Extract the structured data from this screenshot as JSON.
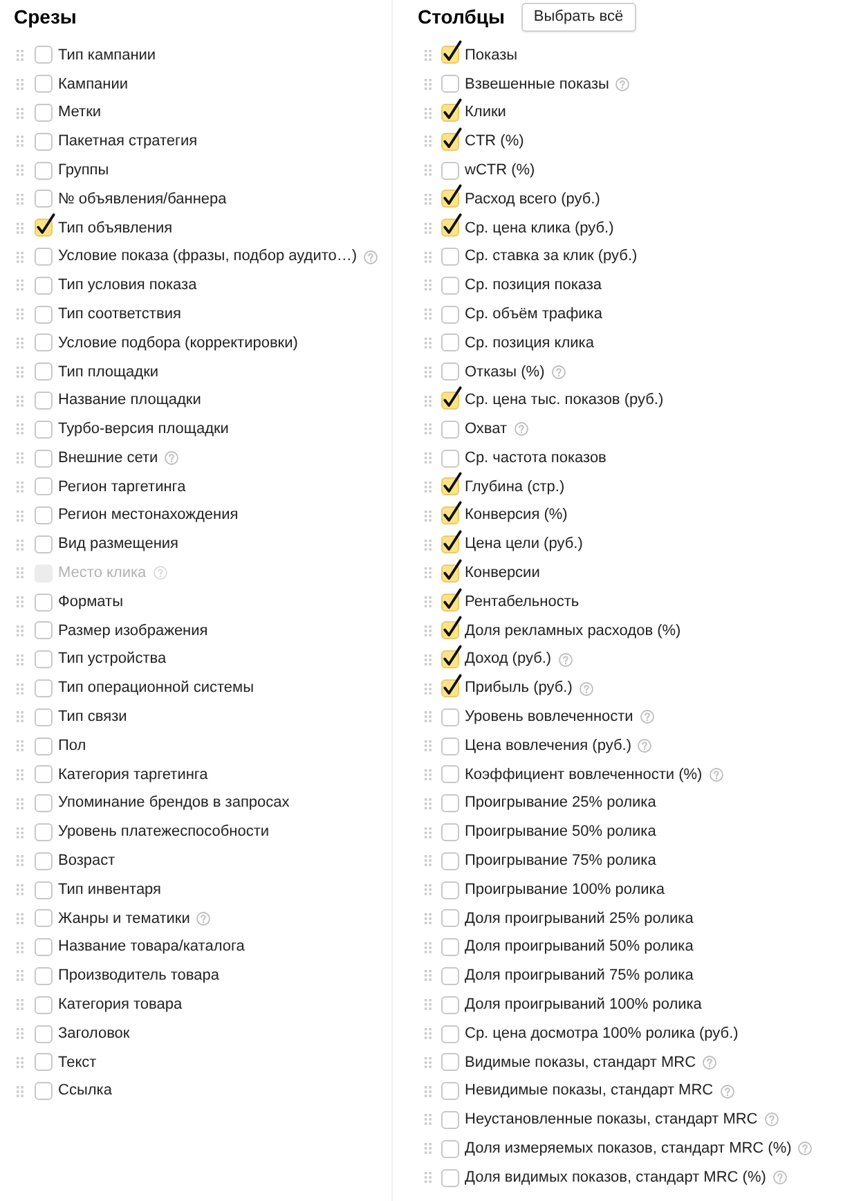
{
  "slices": {
    "title": "Срезы",
    "items": [
      {
        "label": "Тип кампании",
        "checked": false,
        "disabled": false,
        "help": false
      },
      {
        "label": "Кампании",
        "checked": false,
        "disabled": false,
        "help": false
      },
      {
        "label": "Метки",
        "checked": false,
        "disabled": false,
        "help": false
      },
      {
        "label": "Пакетная стратегия",
        "checked": false,
        "disabled": false,
        "help": false
      },
      {
        "label": "Группы",
        "checked": false,
        "disabled": false,
        "help": false
      },
      {
        "label": "№ объявления/баннера",
        "checked": false,
        "disabled": false,
        "help": false
      },
      {
        "label": "Тип объявления",
        "checked": true,
        "disabled": false,
        "help": false
      },
      {
        "label": "Условие показа (фразы, подбор аудито…)",
        "checked": false,
        "disabled": false,
        "help": true
      },
      {
        "label": "Тип условия показа",
        "checked": false,
        "disabled": false,
        "help": false
      },
      {
        "label": "Тип соответствия",
        "checked": false,
        "disabled": false,
        "help": false
      },
      {
        "label": "Условие подбора (корректировки)",
        "checked": false,
        "disabled": false,
        "help": false
      },
      {
        "label": "Тип площадки",
        "checked": false,
        "disabled": false,
        "help": false
      },
      {
        "label": "Название площадки",
        "checked": false,
        "disabled": false,
        "help": false
      },
      {
        "label": "Турбо-версия площадки",
        "checked": false,
        "disabled": false,
        "help": false
      },
      {
        "label": "Внешние сети",
        "checked": false,
        "disabled": false,
        "help": true
      },
      {
        "label": "Регион таргетинга",
        "checked": false,
        "disabled": false,
        "help": false
      },
      {
        "label": "Регион местонахождения",
        "checked": false,
        "disabled": false,
        "help": false
      },
      {
        "label": "Вид размещения",
        "checked": false,
        "disabled": false,
        "help": false
      },
      {
        "label": "Место клика",
        "checked": false,
        "disabled": true,
        "help": true
      },
      {
        "label": "Форматы",
        "checked": false,
        "disabled": false,
        "help": false
      },
      {
        "label": "Размер изображения",
        "checked": false,
        "disabled": false,
        "help": false
      },
      {
        "label": "Тип устройства",
        "checked": false,
        "disabled": false,
        "help": false
      },
      {
        "label": "Тип операционной системы",
        "checked": false,
        "disabled": false,
        "help": false
      },
      {
        "label": "Тип связи",
        "checked": false,
        "disabled": false,
        "help": false
      },
      {
        "label": "Пол",
        "checked": false,
        "disabled": false,
        "help": false
      },
      {
        "label": "Категория таргетинга",
        "checked": false,
        "disabled": false,
        "help": false
      },
      {
        "label": "Упоминание брендов в запросах",
        "checked": false,
        "disabled": false,
        "help": false
      },
      {
        "label": "Уровень платежеспособности",
        "checked": false,
        "disabled": false,
        "help": false
      },
      {
        "label": "Возраст",
        "checked": false,
        "disabled": false,
        "help": false
      },
      {
        "label": "Тип инвентаря",
        "checked": false,
        "disabled": false,
        "help": false
      },
      {
        "label": "Жанры и тематики",
        "checked": false,
        "disabled": false,
        "help": true
      },
      {
        "label": "Название товара/каталога",
        "checked": false,
        "disabled": false,
        "help": false
      },
      {
        "label": "Производитель товара",
        "checked": false,
        "disabled": false,
        "help": false
      },
      {
        "label": "Категория товара",
        "checked": false,
        "disabled": false,
        "help": false
      },
      {
        "label": "Заголовок",
        "checked": false,
        "disabled": false,
        "help": false
      },
      {
        "label": "Текст",
        "checked": false,
        "disabled": false,
        "help": false
      },
      {
        "label": "Ссылка",
        "checked": false,
        "disabled": false,
        "help": false
      }
    ]
  },
  "columns": {
    "title": "Столбцы",
    "select_all_button": "Выбрать всё",
    "items": [
      {
        "label": "Показы",
        "checked": true,
        "help": false
      },
      {
        "label": "Взвешенные показы",
        "checked": false,
        "help": true
      },
      {
        "label": "Клики",
        "checked": true,
        "help": false
      },
      {
        "label": "CTR (%)",
        "checked": true,
        "help": false
      },
      {
        "label": "wCTR (%)",
        "checked": false,
        "help": false
      },
      {
        "label": "Расход всего (руб.)",
        "checked": true,
        "help": false
      },
      {
        "label": "Ср. цена клика (руб.)",
        "checked": true,
        "help": false
      },
      {
        "label": "Ср. ставка за клик (руб.)",
        "checked": false,
        "help": false
      },
      {
        "label": "Ср. позиция показа",
        "checked": false,
        "help": false
      },
      {
        "label": "Ср. объём трафика",
        "checked": false,
        "help": false
      },
      {
        "label": "Ср. позиция клика",
        "checked": false,
        "help": false
      },
      {
        "label": "Отказы (%)",
        "checked": false,
        "help": true
      },
      {
        "label": "Ср. цена тыс. показов (руб.)",
        "checked": true,
        "help": false
      },
      {
        "label": "Охват",
        "checked": false,
        "help": true
      },
      {
        "label": "Ср. частота показов",
        "checked": false,
        "help": false
      },
      {
        "label": "Глубина (стр.)",
        "checked": true,
        "help": false
      },
      {
        "label": "Конверсия (%)",
        "checked": true,
        "help": false
      },
      {
        "label": "Цена цели (руб.)",
        "checked": true,
        "help": false
      },
      {
        "label": "Конверсии",
        "checked": true,
        "help": false
      },
      {
        "label": "Рентабельность",
        "checked": true,
        "help": false
      },
      {
        "label": "Доля рекламных расходов (%)",
        "checked": true,
        "help": false
      },
      {
        "label": "Доход (руб.)",
        "checked": true,
        "help": true
      },
      {
        "label": "Прибыль (руб.)",
        "checked": true,
        "help": true
      },
      {
        "label": "Уровень вовлеченности",
        "checked": false,
        "help": true
      },
      {
        "label": "Цена вовлечения (руб.)",
        "checked": false,
        "help": true
      },
      {
        "label": "Коэффициент вовлеченности (%)",
        "checked": false,
        "help": true
      },
      {
        "label": "Проигрывание 25% ролика",
        "checked": false,
        "help": false
      },
      {
        "label": "Проигрывание 50% ролика",
        "checked": false,
        "help": false
      },
      {
        "label": "Проигрывание 75% ролика",
        "checked": false,
        "help": false
      },
      {
        "label": "Проигрывание 100% ролика",
        "checked": false,
        "help": false
      },
      {
        "label": "Доля проигрываний 25% ролика",
        "checked": false,
        "help": false
      },
      {
        "label": "Доля проигрываний 50% ролика",
        "checked": false,
        "help": false
      },
      {
        "label": "Доля проигрываний 75% ролика",
        "checked": false,
        "help": false
      },
      {
        "label": "Доля проигрываний 100% ролика",
        "checked": false,
        "help": false
      },
      {
        "label": "Ср. цена досмотра 100% ролика (руб.)",
        "checked": false,
        "help": false
      },
      {
        "label": "Видимые показы, стандарт MRC",
        "checked": false,
        "help": true
      },
      {
        "label": "Невидимые показы, стандарт MRC",
        "checked": false,
        "help": true
      },
      {
        "label": "Неустановленные показы, стандарт MRC",
        "checked": false,
        "help": true
      },
      {
        "label": "Доля измеряемых показов, стандарт MRC (%)",
        "checked": false,
        "help": true
      },
      {
        "label": "Доля видимых показов, стандарт MRC (%)",
        "checked": false,
        "help": true
      }
    ]
  }
}
